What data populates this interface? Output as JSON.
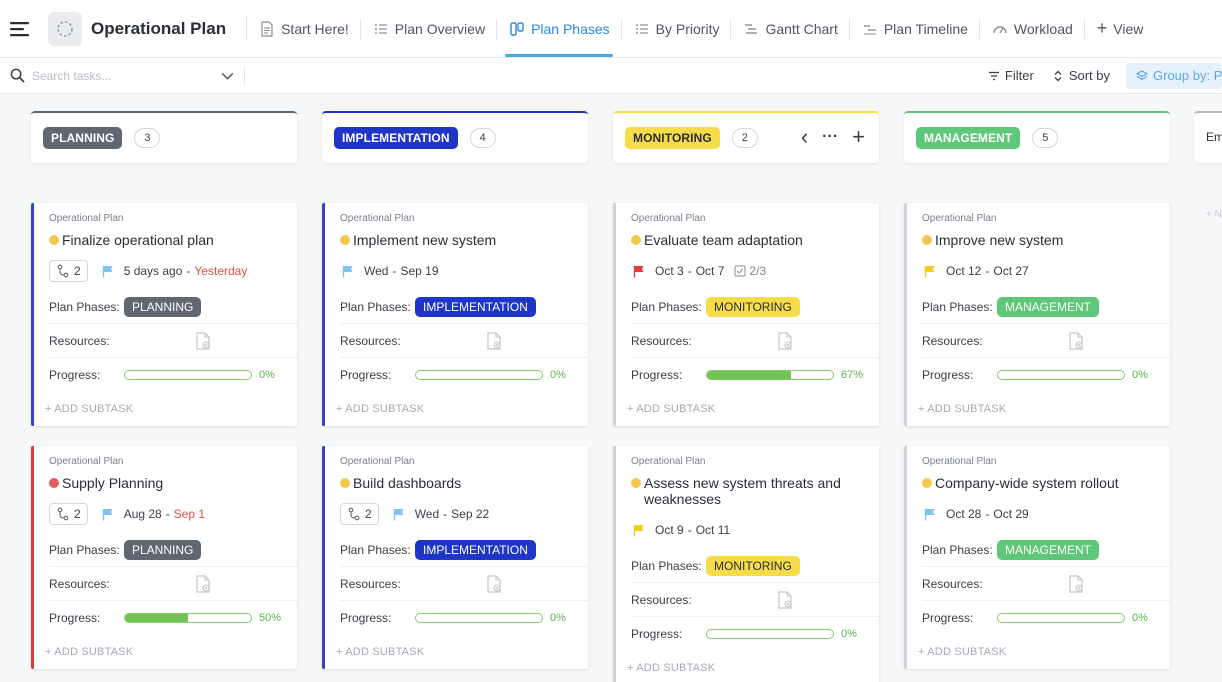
{
  "header": {
    "title": "Operational Plan",
    "tabs": [
      {
        "label": "Start Here!",
        "icon": "doc-icon",
        "active": false
      },
      {
        "label": "Plan Overview",
        "icon": "list-icon",
        "active": false
      },
      {
        "label": "Plan Phases",
        "icon": "board-icon",
        "active": true
      },
      {
        "label": "By Priority",
        "icon": "list-icon",
        "active": false
      },
      {
        "label": "Gantt Chart",
        "icon": "gantt-icon",
        "active": false
      },
      {
        "label": "Plan Timeline",
        "icon": "timeline-icon",
        "active": false
      },
      {
        "label": "Workload",
        "icon": "workload-icon",
        "active": false
      }
    ],
    "view_label": "View"
  },
  "toolbar": {
    "search_placeholder": "Search tasks...",
    "filter_label": "Filter",
    "sort_label": "Sort by",
    "groupby_label": "Group by: Pl"
  },
  "columns": [
    {
      "name": "PLANNING",
      "count": "3",
      "color": "#5f6770",
      "text_color": "#ffffff",
      "cards": [
        {
          "list": "Operational Plan",
          "title": "Finalize operational plan",
          "status_color": "#f2c94c",
          "border": "#3843c6",
          "subtasks": "2",
          "flag_color": "#7fc4ef",
          "date_start": "5 days ago",
          "date_end": "Yesterday",
          "date_end_overdue": true,
          "checklist": "",
          "phase_label": "Plan Phases:",
          "phase": "PLANNING",
          "resources_label": "Resources:",
          "progress_label": "Progress:",
          "progress": 0,
          "progress_text": "0%",
          "add_subtask": "+ ADD SUBTASK"
        },
        {
          "list": "Operational Plan",
          "title": "Supply Planning",
          "status_color": "#e35b5b",
          "border": "#d43f3f",
          "subtasks": "2",
          "flag_color": "#7fc4ef",
          "date_start": "Aug 28",
          "date_end": "Sep 1",
          "date_end_overdue": true,
          "checklist": "",
          "phase_label": "Plan Phases:",
          "phase": "PLANNING",
          "resources_label": "Resources:",
          "progress_label": "Progress:",
          "progress": 50,
          "progress_text": "50%",
          "add_subtask": "+ ADD SUBTASK"
        }
      ]
    },
    {
      "name": "IMPLEMENTATION",
      "count": "4",
      "color": "#1f35c8",
      "text_color": "#ffffff",
      "cards": [
        {
          "list": "Operational Plan",
          "title": "Implement new system",
          "status_color": "#f2c94c",
          "border": "#3843c6",
          "subtasks": "",
          "flag_color": "#7fc4ef",
          "date_start": "Wed",
          "date_end": "Sep 19",
          "date_end_overdue": false,
          "checklist": "",
          "phase_label": "Plan Phases:",
          "phase": "IMPLEMENTATION",
          "resources_label": "Resources:",
          "progress_label": "Progress:",
          "progress": 0,
          "progress_text": "0%",
          "add_subtask": "+ ADD SUBTASK"
        },
        {
          "list": "Operational Plan",
          "title": "Build dashboards",
          "status_color": "#f2c94c",
          "border": "#3843c6",
          "subtasks": "2",
          "flag_color": "#7fc4ef",
          "date_start": "Wed",
          "date_end": "Sep 22",
          "date_end_overdue": false,
          "checklist": "",
          "phase_label": "Plan Phases:",
          "phase": "IMPLEMENTATION",
          "resources_label": "Resources:",
          "progress_label": "Progress:",
          "progress": 0,
          "progress_text": "0%",
          "add_subtask": "+ ADD SUBTASK"
        }
      ]
    },
    {
      "name": "MONITORING",
      "count": "2",
      "color": "#f6dc4a",
      "text_color": "#2a2e34",
      "cards": [
        {
          "list": "Operational Plan",
          "title": "Evaluate team adaptation",
          "status_color": "#f2c94c",
          "border": "#cfd2d6",
          "subtasks": "",
          "flag_color": "#e03e3e",
          "date_start": "Oct 3",
          "date_end": "Oct 7",
          "date_end_overdue": false,
          "checklist": "2/3",
          "phase_label": "Plan Phases:",
          "phase": "MONITORING",
          "resources_label": "Resources:",
          "progress_label": "Progress:",
          "progress": 67,
          "progress_text": "67%",
          "add_subtask": "+ ADD SUBTASK"
        },
        {
          "list": "Operational Plan",
          "title": "Assess new system threats and weaknesses",
          "status_color": "#f2c94c",
          "border": "#cfd2d6",
          "subtasks": "",
          "flag_color": "#f2cf1d",
          "date_start": "Oct 9",
          "date_end": "Oct 11",
          "date_end_overdue": false,
          "checklist": "",
          "phase_label": "Plan Phases:",
          "phase": "MONITORING",
          "resources_label": "Resources:",
          "progress_label": "Progress:",
          "progress": 0,
          "progress_text": "0%",
          "add_subtask": "+ ADD SUBTASK"
        }
      ]
    },
    {
      "name": "MANAGEMENT",
      "count": "5",
      "color": "#5fc77a",
      "text_color": "#ffffff",
      "cards": [
        {
          "list": "Operational Plan",
          "title": "Improve new system",
          "status_color": "#f2c94c",
          "border": "#cfd2d6",
          "subtasks": "",
          "flag_color": "#f2cf1d",
          "date_start": "Oct 12",
          "date_end": "Oct 27",
          "date_end_overdue": false,
          "checklist": "",
          "phase_label": "Plan Phases:",
          "phase": "MANAGEMENT",
          "resources_label": "Resources:",
          "progress_label": "Progress:",
          "progress": 0,
          "progress_text": "0%",
          "add_subtask": "+ ADD SUBTASK"
        },
        {
          "list": "Operational Plan",
          "title": "Company-wide system rollout",
          "status_color": "#f2c94c",
          "border": "#cfd2d6",
          "subtasks": "",
          "flag_color": "#7fc4ef",
          "date_start": "Oct 28",
          "date_end": "Oct 29",
          "date_end_overdue": false,
          "checklist": "",
          "phase_label": "Plan Phases:",
          "phase": "MANAGEMENT",
          "resources_label": "Resources:",
          "progress_label": "Progress:",
          "progress": 0,
          "progress_text": "0%",
          "add_subtask": "+ ADD SUBTASK"
        }
      ]
    }
  ],
  "partial_column": {
    "name_fragment": "Em",
    "add_fragment": "+ N"
  }
}
